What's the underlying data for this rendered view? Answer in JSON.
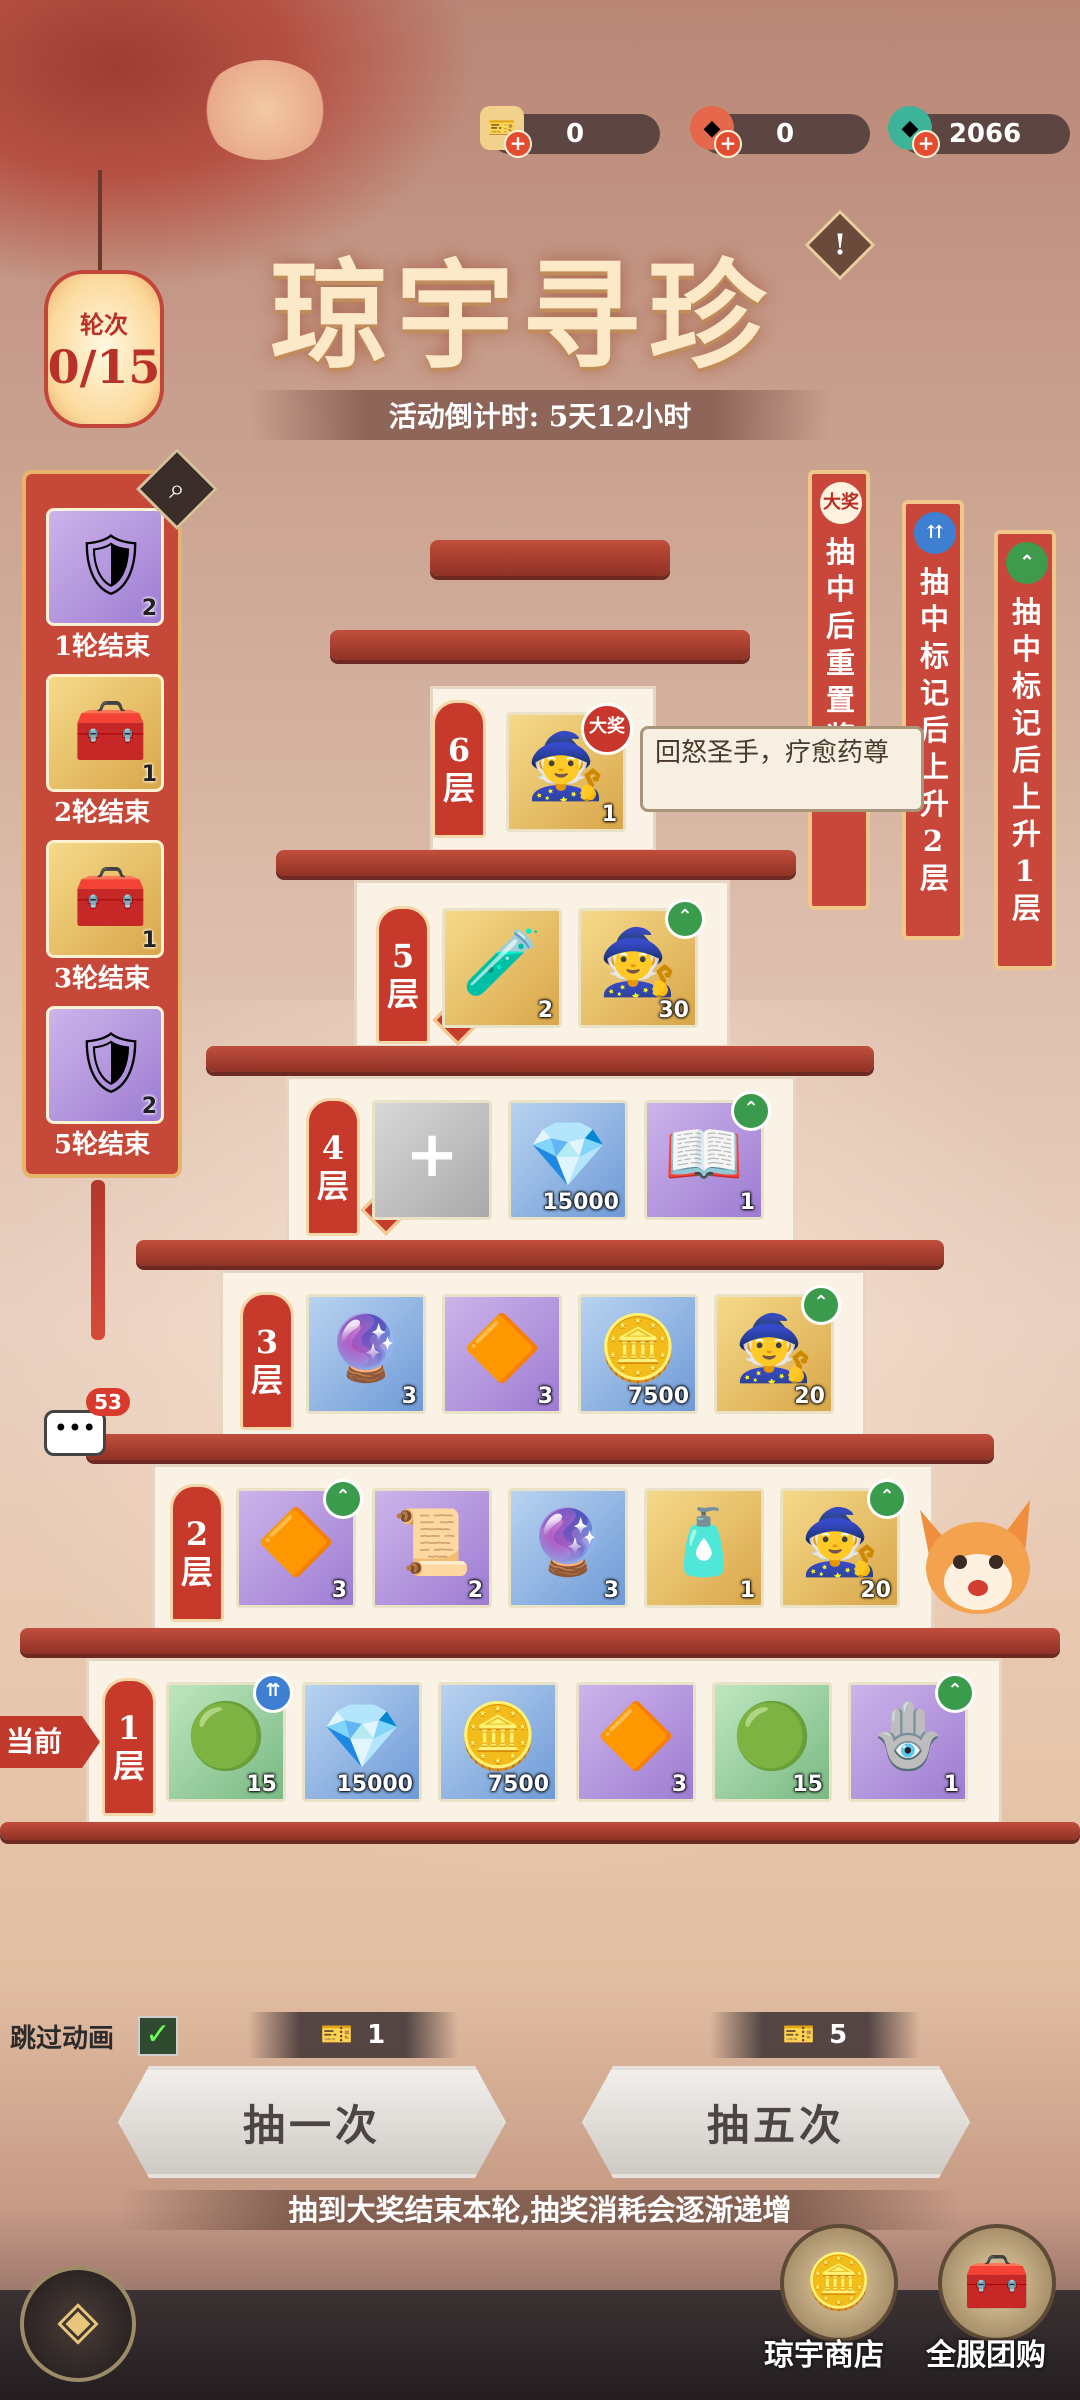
{
  "currencies": [
    {
      "icon": "red-ticket-icon",
      "value": "0"
    },
    {
      "icon": "red-jade-icon",
      "value": "0"
    },
    {
      "icon": "green-jade-icon",
      "value": "2066"
    }
  ],
  "title": "琼宇寻珍",
  "countdown": "活动倒计时: 5天12小时",
  "rounds": {
    "label": "轮次",
    "value": "0/15"
  },
  "round_rewards": [
    {
      "label": "1轮结束",
      "count": "2",
      "icon": "amulet-icon"
    },
    {
      "label": "2轮结束",
      "count": "1",
      "icon": "gold-chest-icon"
    },
    {
      "label": "3轮结束",
      "count": "1",
      "icon": "gold-chest-icon"
    },
    {
      "label": "5轮结束",
      "count": "2",
      "icon": "amulet-icon"
    }
  ],
  "banners": [
    {
      "badge": "大奖",
      "text": "抽中后重置奖励"
    },
    {
      "badge": "⇈",
      "text": "抽中标记后上升2层"
    },
    {
      "badge": "⌃",
      "text": "抽中标记后上升1层"
    }
  ],
  "tooltip": "回怒圣手，疗愈药尊",
  "grand_prize_badge": "大奖",
  "floors": [
    {
      "label": "6层",
      "items": [
        {
          "icon": "hero-portrait-icon",
          "count": "1",
          "bg": "gold"
        }
      ]
    },
    {
      "label": "5层",
      "items": [
        {
          "icon": "red-potion-icon",
          "count": "2",
          "bg": "gold"
        },
        {
          "icon": "hero-portrait-icon",
          "count": "30",
          "bg": "gold"
        }
      ]
    },
    {
      "label": "4层",
      "items": [
        {
          "icon": "add-slot-icon",
          "count": "",
          "bg": "grey"
        },
        {
          "icon": "blue-crystal-icon",
          "count": "15000",
          "bg": "blue"
        },
        {
          "icon": "skill-book-icon",
          "count": "1",
          "bg": "purple"
        }
      ]
    },
    {
      "label": "3层",
      "items": [
        {
          "icon": "blue-orb-icon",
          "count": "3",
          "bg": "blue"
        },
        {
          "icon": "pink-crystal-icon",
          "count": "3",
          "bg": "purple"
        },
        {
          "icon": "gold-coin-icon",
          "count": "7500",
          "bg": "blue"
        },
        {
          "icon": "hero-portrait-icon",
          "count": "20",
          "bg": "gold"
        }
      ]
    },
    {
      "label": "2层",
      "items": [
        {
          "icon": "pink-crystal-icon",
          "count": "3",
          "bg": "purple"
        },
        {
          "icon": "scroll-icon",
          "count": "2",
          "bg": "purple"
        },
        {
          "icon": "blue-orb-icon",
          "count": "3",
          "bg": "blue"
        },
        {
          "icon": "potion-bottle-icon",
          "count": "1",
          "bg": "gold"
        },
        {
          "icon": "hero-portrait-icon",
          "count": "20",
          "bg": "gold"
        }
      ]
    },
    {
      "label": "1层",
      "items": [
        {
          "icon": "green-orb-icon",
          "count": "15",
          "bg": "green"
        },
        {
          "icon": "blue-crystal-icon",
          "count": "15000",
          "bg": "blue"
        },
        {
          "icon": "gold-coin-icon",
          "count": "7500",
          "bg": "blue"
        },
        {
          "icon": "pink-crystal-icon",
          "count": "3",
          "bg": "purple"
        },
        {
          "icon": "green-orb-icon",
          "count": "15",
          "bg": "green"
        },
        {
          "icon": "silver-ornament-icon",
          "count": "1",
          "bg": "purple"
        }
      ]
    }
  ],
  "current_floor": "当前",
  "chat_count": "53",
  "skip_animation": {
    "label": "跳过动画",
    "checked": true
  },
  "draw_once": {
    "label": "抽一次",
    "cost": "1"
  },
  "draw_five": {
    "label": "抽五次",
    "cost": "5"
  },
  "note": "抽到大奖结束本轮,抽奖消耗会逐渐递增",
  "shops": [
    {
      "label": "琼宇商店",
      "icon": "coin-shop-icon"
    },
    {
      "label": "全服团购",
      "icon": "treasure-chest-icon"
    }
  ],
  "colors": {
    "accent_red": "#c7392b",
    "gold": "#e9c77a"
  }
}
